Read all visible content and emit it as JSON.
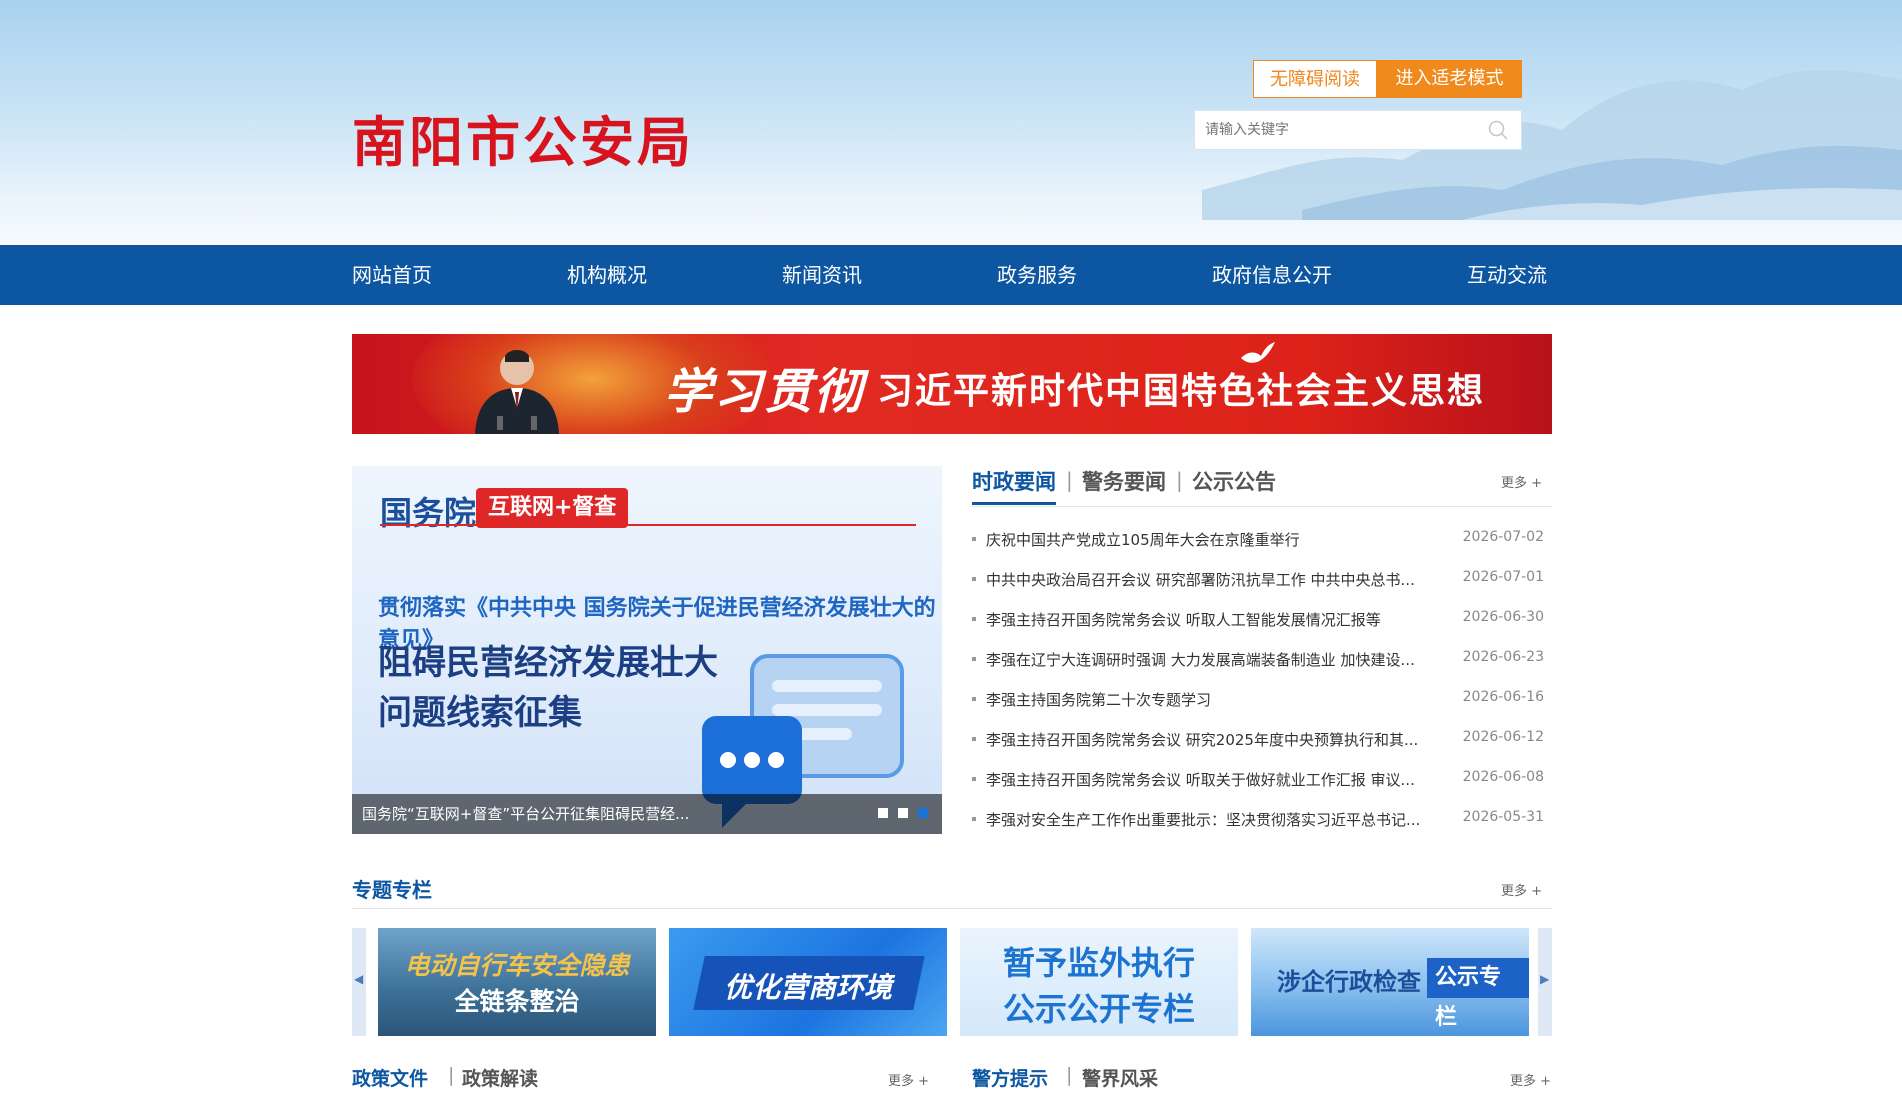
{
  "header": {
    "site_title": "南阳市公安局",
    "accessibility_btn": "无障碍阅读",
    "elder_mode_btn": "进入适老模式",
    "search_placeholder": "请输入关键字"
  },
  "nav": {
    "items": [
      "网站首页",
      "机构概况",
      "新闻资讯",
      "政务服务",
      "政府信息公开",
      "互动交流"
    ]
  },
  "banner": {
    "calligraphy": "学习贯彻",
    "slogan": "习近平新时代中国特色社会主义思想"
  },
  "slide": {
    "brand": "国务院",
    "tag": "互联网+督查",
    "subtitle": "贯彻落实《中共中央 国务院关于促进民营经济发展壮大的意见》",
    "headline_line1": "阻碍民营经济发展壮大",
    "headline_line2": "问题线索征集",
    "caption": "国务院“互联网+督查”平台公开征集阻碍民营经...",
    "dot_count": 3,
    "active_dot": 3
  },
  "news": {
    "tabs": [
      "时政要闻",
      "警务要闻",
      "公示公告"
    ],
    "active_tab": 0,
    "more": "更多 +",
    "items": [
      {
        "title": "庆祝中国共产党成立105周年大会在京隆重举行",
        "date": "2026-07-02"
      },
      {
        "title": "中共中央政治局召开会议 研究部署防汛抗旱工作 中共中央总书...",
        "date": "2026-07-01"
      },
      {
        "title": "李强主持召开国务院常务会议 听取人工智能发展情况汇报等",
        "date": "2026-06-30"
      },
      {
        "title": "李强在辽宁大连调研时强调 大力发展高端装备制造业 加快建设...",
        "date": "2026-06-23"
      },
      {
        "title": "李强主持国务院第二十次专题学习",
        "date": "2026-06-16"
      },
      {
        "title": "李强主持召开国务院常务会议 研究2025年度中央预算执行和其...",
        "date": "2026-06-12"
      },
      {
        "title": "李强主持召开国务院常务会议 听取关于做好就业工作汇报 审议...",
        "date": "2026-06-08"
      },
      {
        "title": "李强对安全生产工作作出重要批示：坚决贯彻落实习近平总书记...",
        "date": "2026-05-31"
      }
    ]
  },
  "special": {
    "title": "专题专栏",
    "more": "更多 +",
    "cards": [
      {
        "line1": "电动自行车安全隐患",
        "line2": "全链条整治"
      },
      {
        "line1": "优化营商环境",
        "line2": ""
      },
      {
        "line1": "暂予监外执行",
        "line2": "公示公开专栏"
      },
      {
        "line1": "涉企行政检查",
        "line2": "公示专栏"
      }
    ]
  },
  "bottom": {
    "left_tabs": [
      "政策文件",
      "政策解读"
    ],
    "left_more": "更多 +",
    "right_tabs": [
      "警方提示",
      "警界风采"
    ],
    "right_more": "更多 +"
  },
  "colors": {
    "nav_blue": "#0d57a2",
    "title_red": "#d7141d",
    "accent_orange": "#f08a1c"
  }
}
